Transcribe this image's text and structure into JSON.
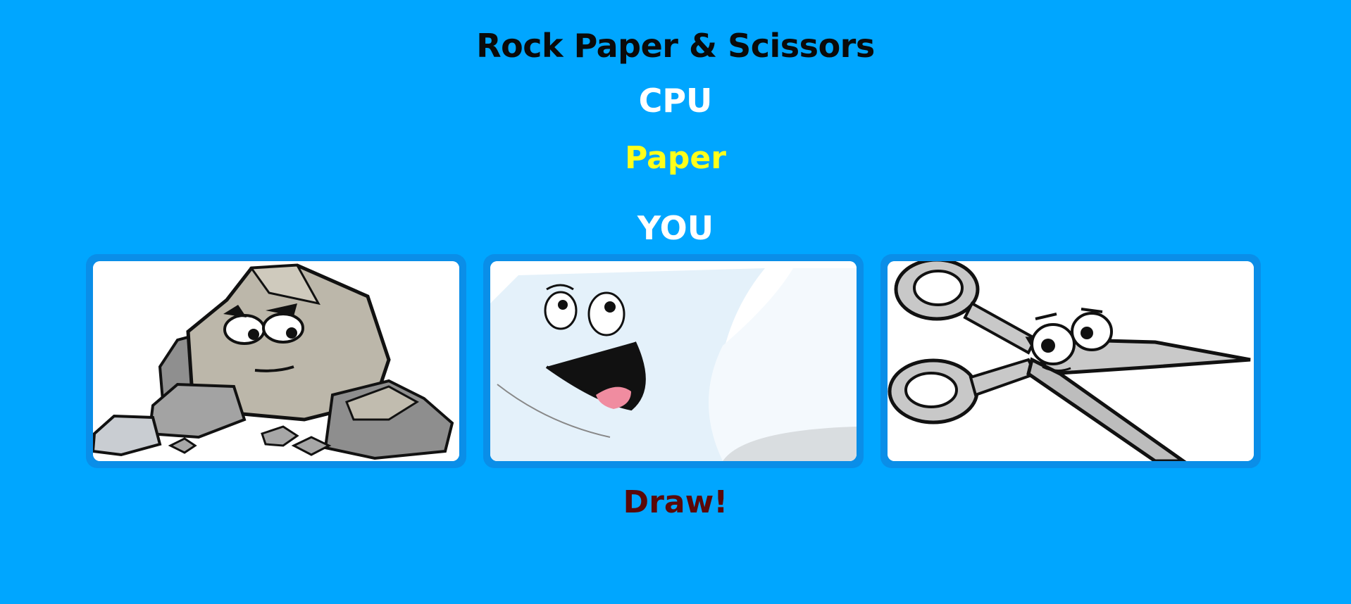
{
  "game": {
    "title": "Rock Paper & Scissors",
    "cpu_label": "CPU",
    "cpu_choice": "Paper",
    "player_label": "YOU",
    "result": "Draw!"
  },
  "choices": [
    {
      "id": "rock",
      "icon": "rock-cartoon-icon"
    },
    {
      "id": "paper",
      "icon": "paper-cartoon-icon"
    },
    {
      "id": "scissors",
      "icon": "scissors-cartoon-icon"
    }
  ],
  "colors": {
    "background": "#00a6ff",
    "title": "#0a0a0a",
    "labels": "#ffffff",
    "cpu_choice": "#ffff1a",
    "result": "#5a0808",
    "card_border": "#0a8ee8"
  }
}
